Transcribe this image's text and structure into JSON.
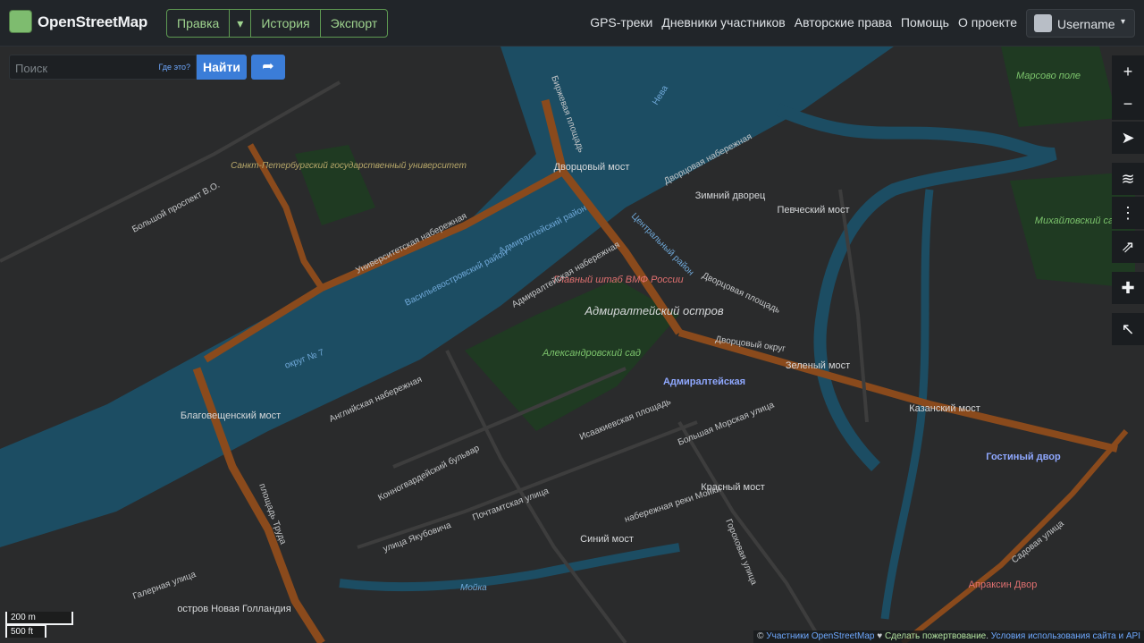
{
  "header": {
    "brand": "OpenStreetMap",
    "edit_label": "Правка",
    "caret": "▾",
    "history_label": "История",
    "export_label": "Экспорт",
    "nav": [
      "GPS-треки",
      "Дневники участников",
      "Авторские права",
      "Помощь",
      "О проекте"
    ],
    "username": "Username",
    "user_caret": "▾"
  },
  "search": {
    "placeholder": "Поиск",
    "where_label": "Где это?",
    "go_label": "Найти"
  },
  "controls": {
    "zoom_in": "+",
    "zoom_out": "−"
  },
  "scale": {
    "metric": "200 m",
    "imperial": "500 ft"
  },
  "attribution": {
    "copyright": "© ",
    "contributors": "Участники OpenStreetMap",
    "heart": " ♥ ",
    "donate": "Сделать пожертвование",
    "separator": ". ",
    "terms": "Условия использования сайта и API"
  },
  "map": {
    "colors": {
      "land": "#2a2b2c",
      "water": "#1c4d63",
      "park": "#1f3a22",
      "road_major": "#8a4a1c",
      "road_minor": "#3d3d3d"
    },
    "labels": [
      "Дворцовый мост",
      "Благовещенский мост",
      "Адмиралтейский остров",
      "Зимний дворец",
      "Певческий мост",
      "Главный штаб ВМФ России",
      "Александровский сад",
      "Адмиралтейская",
      "Зеленый мост",
      "Казанский мост",
      "Красный мост",
      "Синий мост",
      "Гостиный двор",
      "Михайловский сад",
      "Марсово поле",
      "Санкт-Петербургский государственный университет",
      "остров Новая Голландия",
      "Апраксин Двор",
      "Университетская набережная",
      "Адмиралтейская набережная",
      "Английская набережная",
      "Дворцовая набережная",
      "Конногвардейский бульвар",
      "Большой проспект В.О.",
      "Биржевая площадь",
      "Дворцовая площадь",
      "Васильевостровский район",
      "Адмиралтейский район",
      "Центральный район",
      "площадь Труда",
      "Мойка",
      "Нева",
      "округ № 7",
      "Дворцовый округ",
      "Садовая улица",
      "набережная реки Мойки",
      "Большая Морская улица",
      "Почтамтская улица",
      "Гороховая улица",
      "улица Якубовича",
      "Галерная улица",
      "Исаакиевская площадь"
    ]
  }
}
